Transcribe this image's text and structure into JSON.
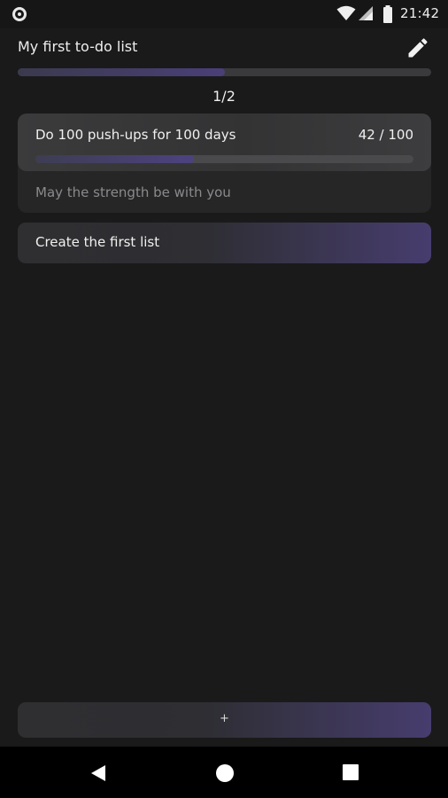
{
  "status_bar": {
    "time": "21:42",
    "icons": [
      "notification-dot-icon",
      "wifi-icon",
      "signal-icon",
      "battery-icon"
    ]
  },
  "list": {
    "title": "My first to-do list",
    "progress_label": "1/2",
    "progress_fraction": 0.5
  },
  "task": {
    "title": "Do 100 push-ups for 100 days",
    "count_label": "42 / 100",
    "progress_fraction": 0.42,
    "note": "May the strength be with you"
  },
  "create_list": {
    "label": "Create the first list"
  },
  "add_button": {
    "label": "+"
  },
  "nav": {
    "icons": [
      "back-icon",
      "home-icon",
      "recents-icon"
    ]
  },
  "colors": {
    "background": "#1a1a1b",
    "accent": "#4a3f78",
    "text": "#eeeeee",
    "muted_text": "#8a8a8c"
  }
}
